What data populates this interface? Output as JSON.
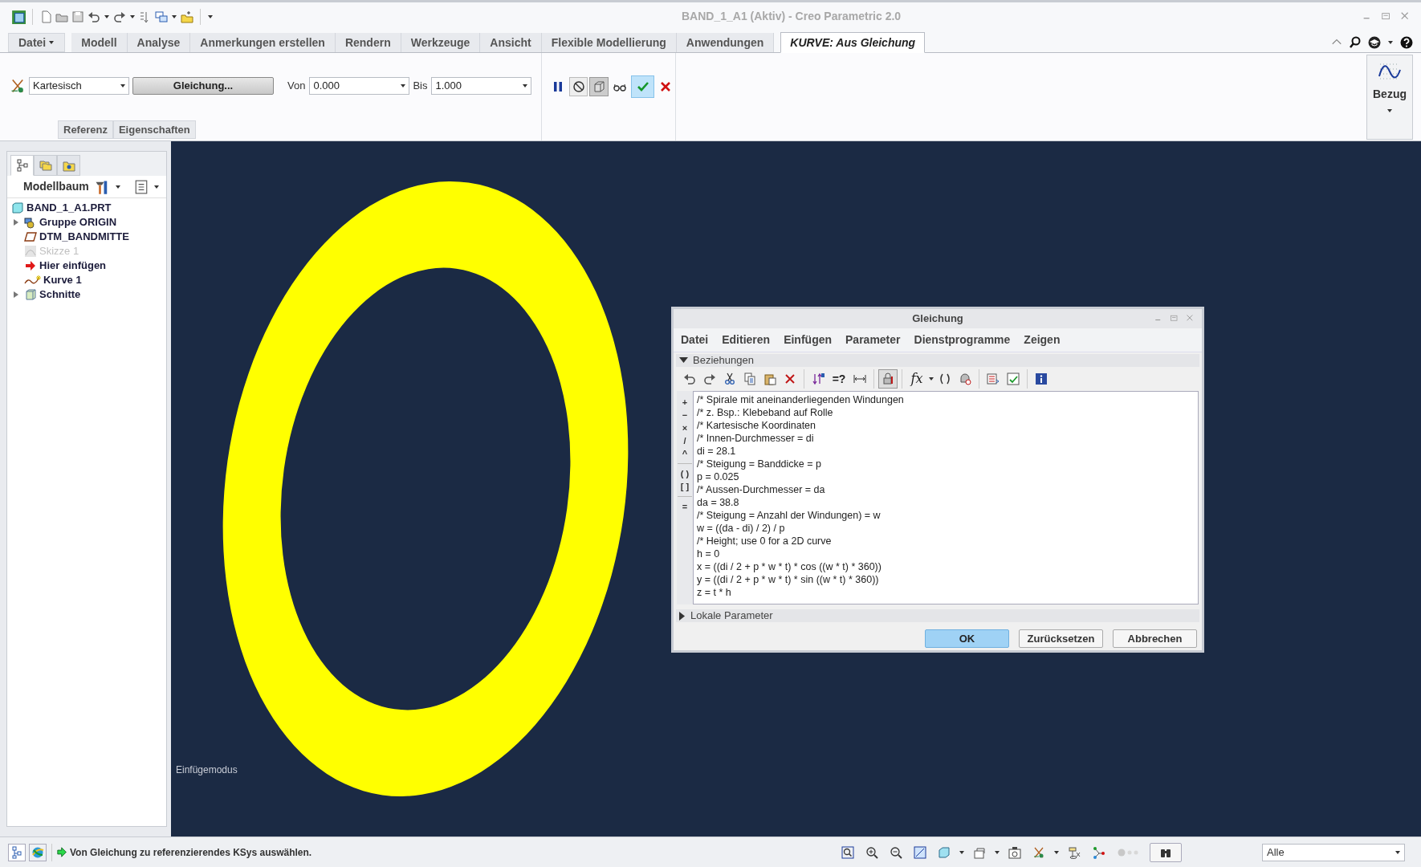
{
  "window": {
    "title": "BAND_1_A1 (Aktiv) - Creo Parametric 2.0"
  },
  "ribbon_tabs": [
    {
      "label": "Datei",
      "kind": "menu",
      "selected": false
    },
    {
      "label": "Modell",
      "kind": "tab",
      "selected": false
    },
    {
      "label": "Analyse",
      "kind": "tab",
      "selected": false
    },
    {
      "label": "Anmerkungen erstellen",
      "kind": "tab",
      "selected": false
    },
    {
      "label": "Rendern",
      "kind": "tab",
      "selected": false
    },
    {
      "label": "Werkzeuge",
      "kind": "tab",
      "selected": false
    },
    {
      "label": "Ansicht",
      "kind": "tab",
      "selected": false
    },
    {
      "label": "Flexible Modellierung",
      "kind": "tab",
      "selected": false
    },
    {
      "label": "Anwendungen",
      "kind": "tab",
      "selected": false
    },
    {
      "label": "KURVE: Aus Gleichung",
      "kind": "tab",
      "selected": true
    }
  ],
  "ribbon": {
    "coord_system": "Kartesisch",
    "equation_button": "Gleichung...",
    "from_label": "Von",
    "from_value": "0.000",
    "to_label": "Bis",
    "to_value": "1.000",
    "subtabs": [
      {
        "label": "Referenz"
      },
      {
        "label": "Eigenschaften"
      }
    ],
    "datum_button": "Bezug"
  },
  "model_tree": {
    "tabs": [
      {
        "kind": "tree",
        "selected": true
      },
      {
        "kind": "layers",
        "selected": false
      },
      {
        "kind": "favorites",
        "selected": false
      }
    ],
    "title": "Modellbaum",
    "items": [
      {
        "label": "BAND_1_A1.PRT",
        "kind": "part",
        "disabled": false,
        "children": [
          {
            "label": "Gruppe ORIGIN",
            "kind": "group",
            "disabled": false,
            "expanded": false
          },
          {
            "label": "DTM_BANDMITTE",
            "kind": "plane",
            "disabled": false
          },
          {
            "label": "Skizze 1",
            "kind": "sketch",
            "disabled": true
          },
          {
            "label": "Hier einfügen",
            "kind": "insert",
            "disabled": false
          },
          {
            "label": "Kurve 1",
            "kind": "curve",
            "disabled": false
          },
          {
            "label": "Schnitte",
            "kind": "sections",
            "disabled": false,
            "expanded": false
          }
        ]
      }
    ]
  },
  "viewport": {
    "mode_label": "Einfügemodus"
  },
  "dialog": {
    "title": "Gleichung",
    "menu": [
      "Datei",
      "Editieren",
      "Einfügen",
      "Parameter",
      "Dienstprogramme",
      "Zeigen"
    ],
    "relations_section": {
      "label": "Beziehungen",
      "expanded": true
    },
    "equals_query_button": "=?",
    "function_button": "fx",
    "operator_groups": [
      [
        "+",
        "−",
        "×",
        "/",
        "^"
      ],
      [
        "( )",
        "[ ]"
      ],
      [
        "="
      ]
    ],
    "lines": [
      "/* Spirale mit aneinanderliegenden Windungen",
      "/* z. Bsp.: Klebeband auf Rolle",
      "/* Kartesische Koordinaten",
      "/* Innen-Durchmesser = di",
      "di = 28.1",
      "/* Steigung = Banddicke = p",
      "p = 0.025",
      "/* Aussen-Durchmesser = da",
      "da = 38.8",
      "/* Steigung = Anzahl der Windungen) = w",
      "w = ((da - di) / 2) / p",
      "/* Height; use 0 for a 2D curve",
      "h = 0",
      "x = ((di / 2 + p * w * t) * cos ((w * t) * 360))",
      "y = ((di / 2 + p * w * t) * sin ((w * t) * 360))",
      "z = t * h"
    ],
    "local_section": {
      "label": "Lokale Parameter",
      "expanded": false
    },
    "buttons": [
      {
        "label": "OK",
        "kind": "default"
      },
      {
        "label": "Zurücksetzen",
        "kind": "normal"
      },
      {
        "label": "Abbrechen",
        "kind": "normal"
      }
    ]
  },
  "status_bar": {
    "message": "Von Gleichung zu referenzierendes KSys auswählen.",
    "filter": "Alle"
  }
}
